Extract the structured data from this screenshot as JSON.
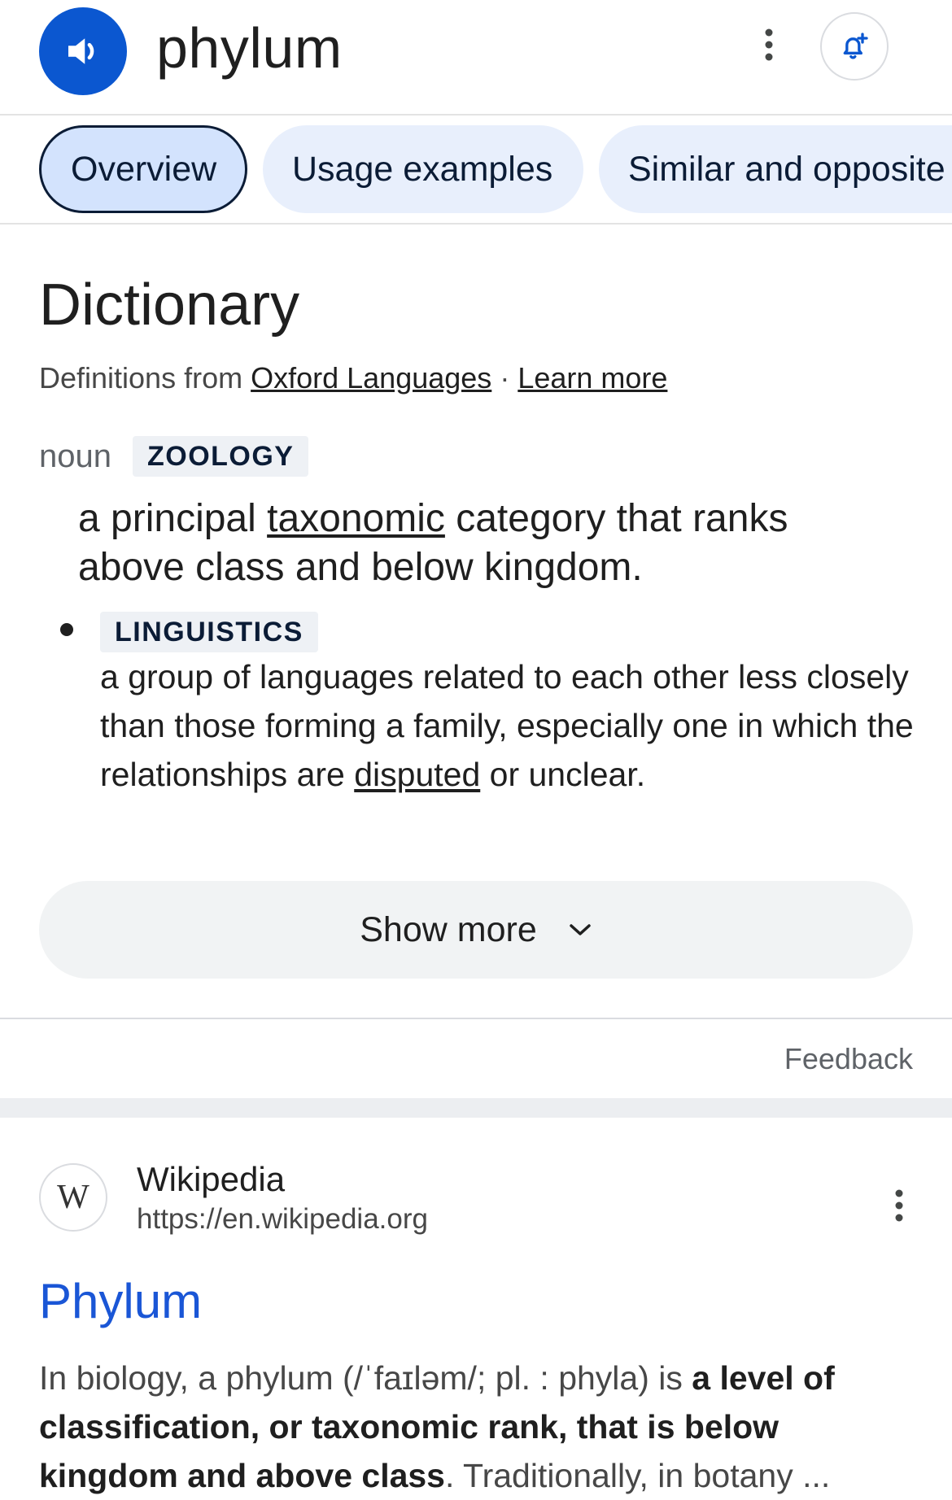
{
  "header": {
    "word": "phylum",
    "speaker_icon": "volume-icon",
    "more_icon": "more-vert-icon",
    "alert_icon": "add-alert-icon"
  },
  "tabs": [
    {
      "label": "Overview",
      "active": true
    },
    {
      "label": "Usage examples",
      "active": false
    },
    {
      "label": "Similar and opposite",
      "active": false
    }
  ],
  "dictionary": {
    "heading": "Dictionary",
    "source_prefix": "Definitions from ",
    "source_link": "Oxford Languages",
    "separator": " · ",
    "learn_more": "Learn more",
    "part_of_speech": "noun",
    "main_label": "ZOOLOGY",
    "main_def_before": "a principal ",
    "main_def_link": "taxonomic",
    "main_def_after": " category that ranks above class and below kingdom.",
    "sub_label": "LINGUISTICS",
    "sub_def_before": "a group of languages related to each other less closely than those forming a family, especially one in which the relationships are ",
    "sub_def_link": "disputed",
    "sub_def_after": " or unclear.",
    "show_more": "Show more",
    "feedback": "Feedback"
  },
  "result": {
    "site_name": "Wikipedia",
    "url": "https://en.wikipedia.org",
    "favicon_letter": "W",
    "title": "Phylum",
    "snippet_before": "In biology, a phylum (/ˈfaɪləm/; pl. : phyla) is ",
    "snippet_bold": "a level of classification, or taxonomic rank, that is below kingdom and above class",
    "snippet_after": ". Traditionally, in botany ..."
  },
  "colors": {
    "accent": "#0b57d0",
    "link": "#1a56d6",
    "tab_bg": "#e8effc",
    "tab_active_bg": "#d3e3fd"
  }
}
